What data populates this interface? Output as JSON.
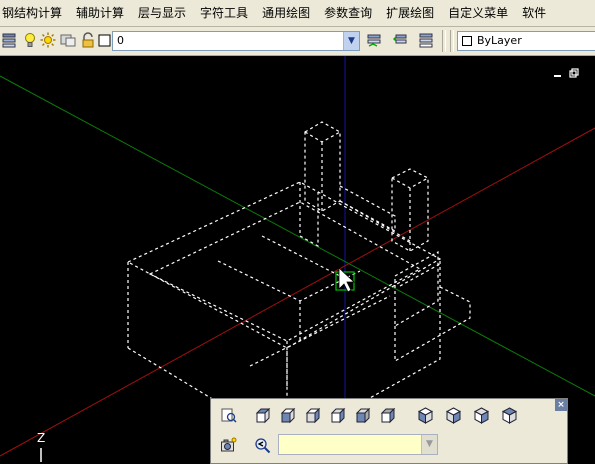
{
  "menubar": {
    "items": [
      "钢结构计算",
      "辅助计算",
      "层与显示",
      "字符工具",
      "通用绘图",
      "参数查询",
      "扩展绘图",
      "自定义菜单",
      "软件"
    ]
  },
  "layers_toolbar": {
    "current_layer": "0",
    "icons": [
      "layer-manager-icon",
      "lightbulb-icon",
      "sun-freeze-icon",
      "layer-lock-icon",
      "color-swatch-icon"
    ]
  },
  "properties_toolbar": {
    "color_value": "ByLayer"
  },
  "drawing": {
    "axis_label": "Z",
    "colors": {
      "background": "#000000",
      "x_axis": "#8b0000",
      "y_axis": "#006400",
      "z_axis": "#00008b",
      "wireframe": "#ffffff"
    }
  },
  "floating_toolbar": {
    "close_label": "×",
    "icons": [
      "view-manager-icon",
      "top-view-icon",
      "bottom-view-icon",
      "left-view-icon",
      "right-view-icon",
      "front-view-icon",
      "back-view-icon",
      "sw-iso-icon",
      "se-iso-icon",
      "ne-iso-icon",
      "nw-iso-icon",
      "camera-icon",
      "zoom-previous-icon"
    ],
    "ucs_value": ""
  }
}
